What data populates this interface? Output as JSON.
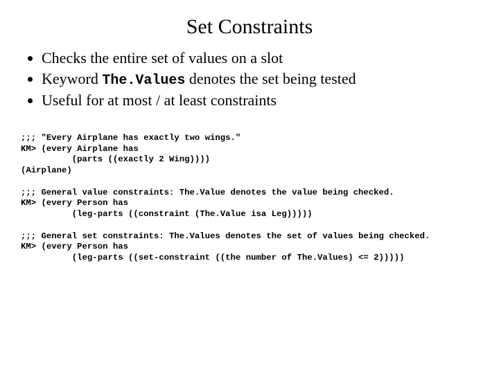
{
  "title": "Set Constraints",
  "bullets": [
    {
      "pre": "Checks the entire set of values on a slot",
      "kw": "",
      "post": ""
    },
    {
      "pre": "Keyword ",
      "kw": "The.Values",
      "post": " denotes the set being tested"
    },
    {
      "pre": "Useful for at most / at least constraints",
      "kw": "",
      "post": ""
    }
  ],
  "code": ";;; \"Every Airplane has exactly two wings.\"\nKM> (every Airplane has\n          (parts ((exactly 2 Wing))))\n(Airplane)\n\n;;; General value constraints: The.Value denotes the value being checked.\nKM> (every Person has\n          (leg-parts ((constraint (The.Value isa Leg)))))\n\n;;; General set constraints: The.Values denotes the set of values being checked.\nKM> (every Person has\n          (leg-parts ((set-constraint ((the number of The.Values) <= 2)))))"
}
